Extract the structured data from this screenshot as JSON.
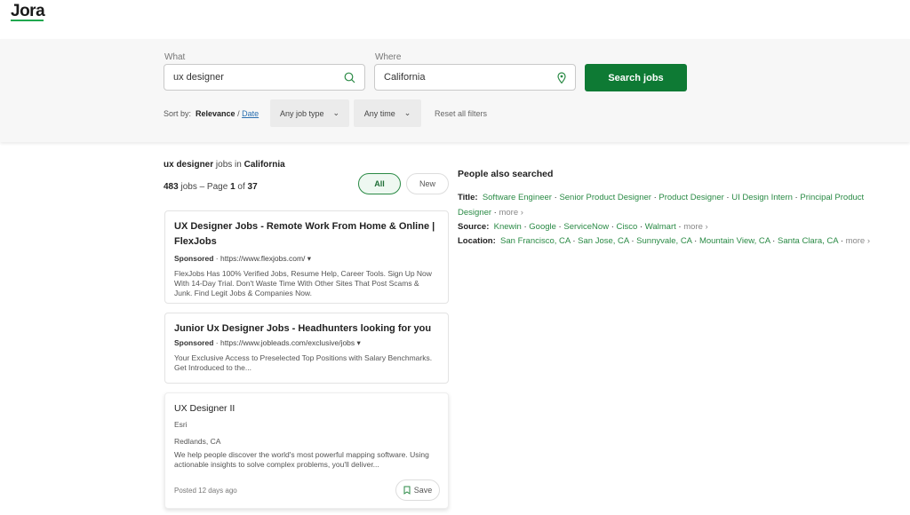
{
  "header": {
    "logo": "Jora"
  },
  "search": {
    "what_label": "What",
    "what_value": "ux designer",
    "where_label": "Where",
    "where_value": "California",
    "button": "Search jobs"
  },
  "filters": {
    "sort_label": "Sort by:",
    "sort_relevance": "Relevance",
    "sep": "/",
    "sort_date": "Date",
    "job_type": "Any job type",
    "time": "Any time",
    "reset": "Reset all filters"
  },
  "results": {
    "query": "ux designer",
    "jobs_in": "jobs in",
    "location": "California",
    "count": "483",
    "count_text": "jobs – Page",
    "page": "1",
    "of": "of",
    "pages": "37",
    "tab_all": "All",
    "tab_new": "New"
  },
  "cards": [
    {
      "title": "UX Designer Jobs - Remote Work From Home & Online | FlexJobs",
      "sponsored": "Sponsored",
      "url": "https://www.flexjobs.com/",
      "desc": "FlexJobs Has 100% Verified Jobs, Resume Help, Career Tools. Sign Up Now With 14-Day Trial. Don't Waste Time With Other Sites That Post Scams & Junk. Find Legit Jobs & Companies Now."
    },
    {
      "title": "Junior Ux Designer Jobs - Headhunters looking for you",
      "sponsored": "Sponsored",
      "url": "https://www.jobleads.com/exclusive/jobs",
      "desc": "Your Exclusive Access to Preselected Top Positions with Salary Benchmarks. Get Introduced to the..."
    }
  ],
  "job": {
    "title": "UX Designer II",
    "company": "Esri",
    "location": "Redlands, CA",
    "desc": "We help people discover the world's most powerful mapping software. Using actionable insights to solve complex problems, you'll deliver...",
    "posted": "Posted 12 days ago",
    "save": "Save"
  },
  "also": {
    "heading": "People also searched",
    "title_label": "Title:",
    "titles": [
      "Software Engineer",
      "Senior Product Designer",
      "Product Designer",
      "UI Design Intern",
      "Principal Product Designer"
    ],
    "source_label": "Source:",
    "sources": [
      "Knewin",
      "Google",
      "ServiceNow",
      "Cisco",
      "Walmart"
    ],
    "location_label": "Location:",
    "locations": [
      "San Francisco, CA",
      "San Jose, CA",
      "Sunnyvale, CA",
      "Mountain View, CA",
      "Santa Clara, CA"
    ],
    "more": "more ›"
  }
}
